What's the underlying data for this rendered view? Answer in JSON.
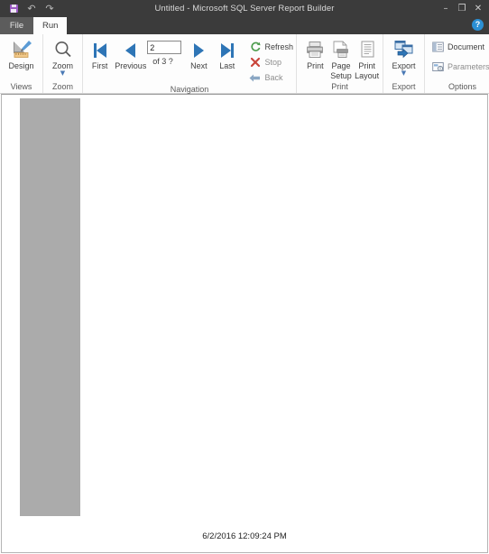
{
  "window": {
    "title": "Untitled - Microsoft SQL Server Report Builder",
    "quick_access": [
      {
        "name": "save",
        "label": "Save",
        "icon": "save-icon",
        "color": "#9b59c4"
      },
      {
        "name": "undo",
        "label": "Undo",
        "icon": "undo-icon",
        "glyph": "↶"
      },
      {
        "name": "redo",
        "label": "Redo",
        "icon": "redo-icon",
        "glyph": "↷"
      }
    ],
    "controls": [
      {
        "name": "minimize",
        "glyph": "–"
      },
      {
        "name": "restore",
        "glyph": "❐"
      },
      {
        "name": "close",
        "glyph": "✕"
      }
    ],
    "help_label": "?"
  },
  "tabs": [
    {
      "label": "File",
      "active": false
    },
    {
      "label": "Run",
      "active": true
    }
  ],
  "ribbon": {
    "groups": [
      {
        "name": "views",
        "label": "Views",
        "buttons": [
          {
            "label": "Design",
            "icon": "design-ruler-icon"
          }
        ]
      },
      {
        "name": "zoom",
        "label": "Zoom",
        "buttons": [
          {
            "label": "Zoom",
            "icon": "magnifier-icon",
            "has_dropdown": true
          }
        ]
      },
      {
        "name": "navigation",
        "label": "Navigation",
        "buttons": [
          {
            "label": "First",
            "icon": "nav-first-icon"
          },
          {
            "label": "Previous",
            "icon": "nav-previous-icon"
          },
          {
            "label": "Next",
            "icon": "nav-next-icon"
          },
          {
            "label": "Last",
            "icon": "nav-last-icon"
          }
        ],
        "page_input": {
          "value": "2",
          "placeholder": "",
          "of_text": "of  3 ?"
        },
        "commands": [
          {
            "label": "Refresh",
            "icon": "refresh-icon",
            "color": "#4a9b4a"
          },
          {
            "label": "Stop",
            "icon": "stop-x-icon",
            "color": "#c9453b"
          },
          {
            "label": "Back",
            "icon": "back-arrow-icon",
            "color": "#7d9bbc"
          }
        ]
      },
      {
        "name": "print",
        "label": "Print",
        "buttons": [
          {
            "label": "Print",
            "icon": "printer-icon"
          },
          {
            "label": "Page\nSetup",
            "line1": "Page",
            "line2": "Setup",
            "icon": "page-setup-icon"
          },
          {
            "label": "Print\nLayout",
            "line1": "Print",
            "line2": "Layout",
            "icon": "print-layout-icon"
          }
        ]
      },
      {
        "name": "export",
        "label": "Export",
        "buttons": [
          {
            "label": "Export",
            "icon": "export-icon",
            "has_dropdown": true
          }
        ]
      },
      {
        "name": "options",
        "label": "Options",
        "commands": [
          {
            "label": "Document",
            "icon": "document-map-icon",
            "has_arrow": false
          },
          {
            "label": "Parameters",
            "icon": "parameters-icon",
            "has_arrow": true
          }
        ]
      }
    ]
  },
  "document": {
    "footer_timestamp": "6/2/2016 12:09:24 PM",
    "placeholder_block": {
      "color": "#ababab"
    }
  }
}
